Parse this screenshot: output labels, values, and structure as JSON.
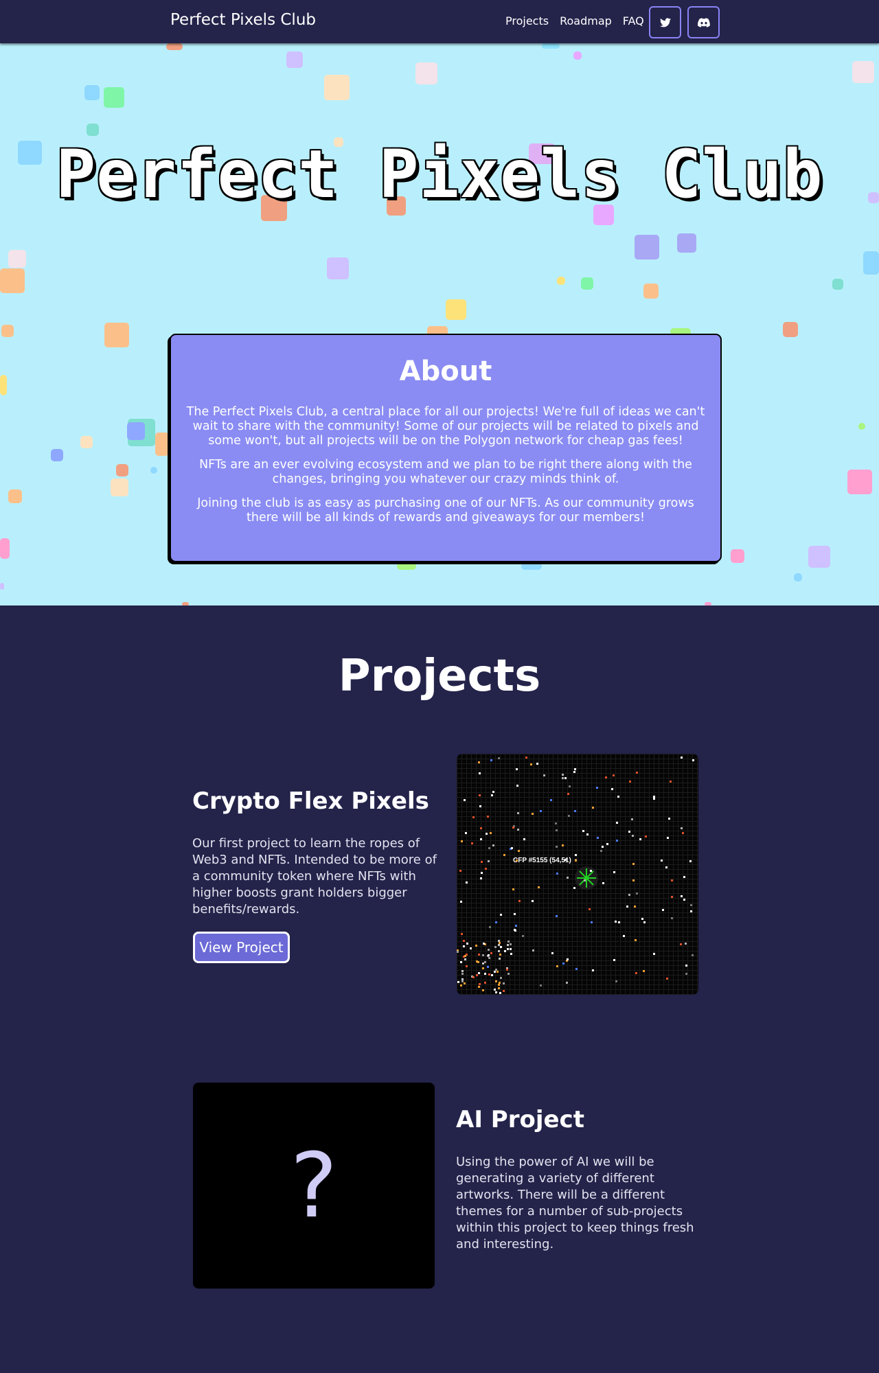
{
  "nav": {
    "brand": "Perfect Pixels Club",
    "links": [
      "Projects",
      "Roadmap",
      "FAQ"
    ],
    "icons": [
      "twitter-icon",
      "discord-icon"
    ]
  },
  "hero": {
    "title": "Perfect Pixels Club"
  },
  "about": {
    "heading": "About",
    "paragraphs": [
      "The Perfect Pixels Club, a central place for all our projects! We're full of ideas we can't wait to share with the community! Some of our projects will be related to pixels and some won't, but all projects will be on the Polygon network for cheap gas fees!",
      "NFTs are an ever evolving ecosystem and we plan to be right there along with the changes, bringing you whatever our crazy minds think of.",
      "Joining the club is as easy as purchasing one of our NFTs. As our community grows there will be all kinds of rewards and giveaways for our members!"
    ]
  },
  "projects": {
    "heading": "Projects",
    "items": [
      {
        "name": "Crypto Flex Pixels",
        "description": "Our first project to learn the ropes of Web3 and NFTs. Intended to be more of a community token where NFTs with higher boosts grant holders bigger benefits/rewards.",
        "button": "View Project",
        "image_label": "CFP #5155 (54,51)"
      },
      {
        "name": "AI Project",
        "description": "Using the power of AI we will be generating a variety of different artworks. There will be a different themes for a number of sub-projects within this project to keep things fresh and interesting.",
        "placeholder": "?"
      }
    ]
  },
  "colors": {
    "navy": "#24234a",
    "sky": "#b9effc",
    "about_bg": "#8a8cf3",
    "accent": "#8a84f5"
  }
}
